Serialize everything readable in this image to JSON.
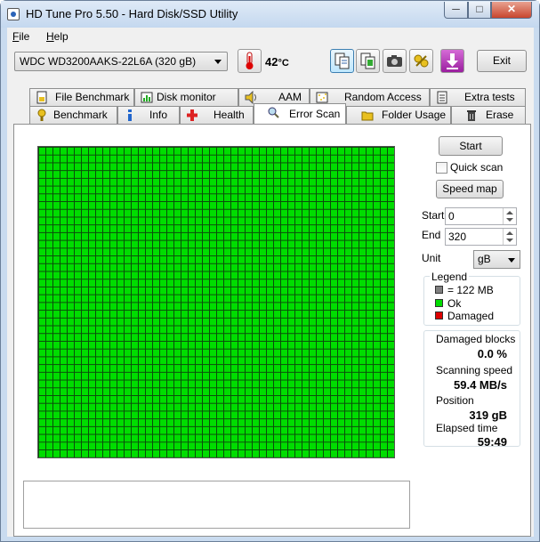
{
  "window": {
    "title": "HD Tune Pro 5.50 - Hard Disk/SSD Utility",
    "minimize": "─",
    "maximize": "□",
    "close": "✕"
  },
  "menu": {
    "file": "File",
    "help": "Help"
  },
  "toolbar": {
    "drive": "WDC    WD3200AAKS-22L6A (320 gB)",
    "temperature": "42",
    "temp_unit": "°C",
    "exit_label": "Exit"
  },
  "tabs_top": [
    {
      "label": "File Benchmark",
      "icon": "file-benchmark-icon"
    },
    {
      "label": "Disk monitor",
      "icon": "disk-monitor-icon"
    },
    {
      "label": "AAM",
      "icon": "speaker-icon"
    },
    {
      "label": "Random Access",
      "icon": "random-access-icon"
    },
    {
      "label": "Extra tests",
      "icon": "extra-tests-icon"
    }
  ],
  "tabs_bottom": [
    {
      "label": "Benchmark",
      "icon": "benchmark-icon"
    },
    {
      "label": "Info",
      "icon": "info-icon"
    },
    {
      "label": "Health",
      "icon": "health-icon"
    },
    {
      "label": "Error Scan",
      "icon": "magnifier-icon",
      "active": true
    },
    {
      "label": "Folder Usage",
      "icon": "folder-icon"
    },
    {
      "label": "Erase",
      "icon": "trash-icon"
    }
  ],
  "controls": {
    "start_label": "Start",
    "quick_scan_label": "Quick scan",
    "quick_scan_checked": false,
    "speed_map_label": "Speed map",
    "start_field_label": "Start",
    "start_value": "0",
    "end_field_label": "End",
    "end_value": "320",
    "unit_label": "Unit",
    "unit_value": "gB"
  },
  "legend": {
    "title": "Legend",
    "items": [
      {
        "label": "= 122 MB",
        "color": "#7f7f7f"
      },
      {
        "label": "Ok",
        "color": "#00dd00"
      },
      {
        "label": "Damaged",
        "color": "#dd0000"
      }
    ]
  },
  "stats": {
    "damaged_blocks_label": "Damaged blocks",
    "damaged_blocks_value": "0.0 %",
    "scanning_speed_label": "Scanning speed",
    "scanning_speed_value": "59.4 MB/s",
    "position_label": "Position",
    "position_value": "319 gB",
    "elapsed_label": "Elapsed time",
    "elapsed_value": "59:49"
  },
  "scan_map": {
    "columns": 50,
    "rows": 40,
    "block_status": "ok",
    "color_ok": "#00dd00",
    "gridline_color": "#0b4d0b"
  }
}
